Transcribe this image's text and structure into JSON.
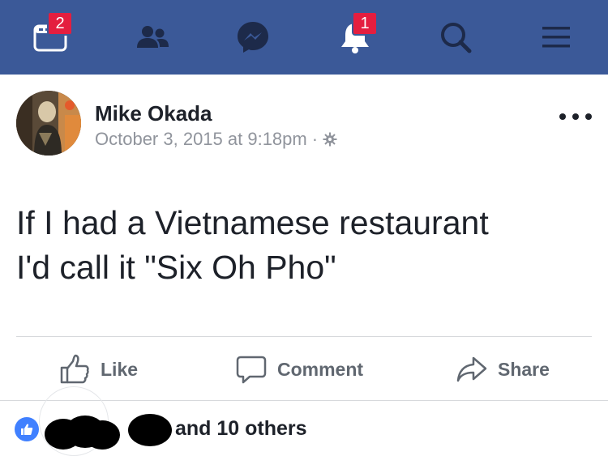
{
  "navbar": {
    "background_color": "#3b5998",
    "items": [
      {
        "name": "news-feed-icon",
        "badge": "2"
      },
      {
        "name": "friends-icon",
        "badge": ""
      },
      {
        "name": "messenger-icon",
        "badge": ""
      },
      {
        "name": "notifications-icon",
        "badge": "1"
      },
      {
        "name": "search-icon",
        "badge": ""
      },
      {
        "name": "menu-icon",
        "badge": ""
      }
    ]
  },
  "post": {
    "author": "Mike Okada",
    "timestamp": "October 3, 2015 at 9:18pm",
    "separator": "·",
    "privacy_icon": "gear-icon",
    "text": "If I had a Vietnamese restaurant\nI'd call it \"Six Oh Pho\""
  },
  "actions": {
    "like_label": "Like",
    "comment_label": "Comment",
    "share_label": "Share"
  },
  "reactions": {
    "summary_text": "and 10 others",
    "like_color": "#4080ff"
  }
}
